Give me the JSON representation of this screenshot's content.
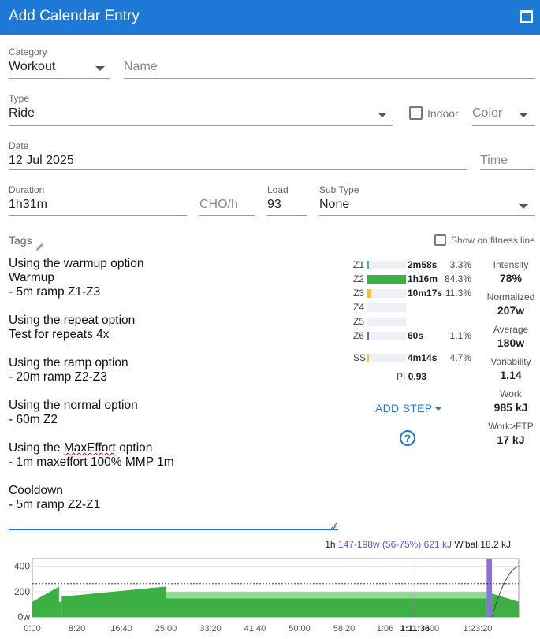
{
  "window": {
    "title": "Add Calendar Entry"
  },
  "form": {
    "category": {
      "label": "Category",
      "value": "Workout"
    },
    "name": {
      "placeholder": "Name"
    },
    "type": {
      "label": "Type",
      "value": "Ride"
    },
    "indoor": {
      "label": "Indoor",
      "checked": false
    },
    "color": {
      "placeholder": "Color"
    },
    "date": {
      "label": "Date",
      "value": "12 Jul 2025"
    },
    "time": {
      "placeholder": "Time"
    },
    "duration": {
      "label": "Duration",
      "value": "1h31m"
    },
    "cho": {
      "placeholder": "CHO/h"
    },
    "load": {
      "label": "Load",
      "value": "93"
    },
    "subtype": {
      "label": "Sub Type",
      "value": "None"
    },
    "tags": {
      "label": "Tags"
    },
    "fitness_line": {
      "label": "Show on fitness line",
      "checked": false
    }
  },
  "description": {
    "lines": [
      "Using the warmup option",
      "Warmup",
      "- 5m ramp Z1-Z3",
      "",
      "Using the repeat option",
      "Test for repeats 4x",
      "",
      "Using the ramp option",
      "- 20m ramp Z2-Z3",
      "",
      "Using the normal option",
      "- 60m Z2",
      "",
      "Using the ",
      "- 1m maxeffort 100% MMP 1m",
      "",
      "Cooldown",
      "- 5m ramp Z2-Z1"
    ],
    "maxeffort_word": "MaxEffort",
    "maxeffort_suffix": " option"
  },
  "zones": [
    {
      "name": "Z1",
      "time": "2m58s",
      "pct": "3.3%",
      "frac": 0.033,
      "color": "#3cbf8f"
    },
    {
      "name": "Z2",
      "time": "1h16m",
      "pct": "84.3%",
      "frac": 1.0,
      "color": "#3cb043"
    },
    {
      "name": "Z3",
      "time": "10m17s",
      "pct": "11.3%",
      "frac": 0.12,
      "color": "#f5c12e"
    },
    {
      "name": "Z4",
      "time": "",
      "pct": "",
      "frac": 0,
      "color": "#f08a24"
    },
    {
      "name": "Z5",
      "time": "",
      "pct": "",
      "frac": 0,
      "color": "#e5484d"
    },
    {
      "name": "Z6",
      "time": "60s",
      "pct": "1.1%",
      "frac": 0.02,
      "color": "#9b59b6"
    },
    {
      "name": "SS",
      "time": "4m14s",
      "pct": "4.7%",
      "frac": 0.06,
      "color": "#f5c12e"
    }
  ],
  "pi": {
    "label": "PI",
    "value": "0.93"
  },
  "actions": {
    "add_step": "ADD STEP",
    "help": "?"
  },
  "metrics": [
    {
      "label": "Intensity",
      "value": "78%"
    },
    {
      "label": "Normalized",
      "value": "207w"
    },
    {
      "label": "Average",
      "value": "180w"
    },
    {
      "label": "Variability",
      "value": "1.14"
    },
    {
      "label": "Work",
      "value": "985 kJ"
    },
    {
      "label": "Work>FTP",
      "value": "17 kJ"
    }
  ],
  "chart_info": {
    "time": "1h",
    "range": "147-198w (56-75%)",
    "work": "621 kJ",
    "wbal": "W'bal 18.2 kJ"
  },
  "chart_data": {
    "type": "area",
    "y_ticks": [
      "400",
      "200",
      "0w"
    ],
    "ylim": [
      0,
      460
    ],
    "x_ticks": [
      "0:00",
      "8:20",
      "16:40",
      "25:00",
      "33:20",
      "41:40",
      "50:00",
      "58:20",
      "1:06",
      "1:11:36",
      ":00",
      "1:23:20"
    ],
    "x_tick_seconds": [
      0,
      500,
      1000,
      1500,
      2000,
      2500,
      3000,
      3500,
      3960,
      4296,
      4500,
      5000
    ],
    "xlim_seconds": [
      0,
      5460
    ],
    "ftp_line_watts": 263,
    "cursor_seconds": 4296,
    "steps": [
      {
        "from_s": 0,
        "to_s": 300,
        "w_start": 120,
        "w_end": 240
      },
      {
        "from_s": 300,
        "to_s": 330,
        "w_start": 120,
        "w_end": 120
      },
      {
        "from_s": 330,
        "to_s": 1500,
        "w_start": 160,
        "w_end": 240
      },
      {
        "from_s": 1500,
        "to_s": 5100,
        "w_start": 198,
        "w_end": 198,
        "band_low": 147
      },
      {
        "from_s": 5100,
        "to_s": 5160,
        "w_start": 460,
        "w_end": 460,
        "color": "#8e6ee0"
      },
      {
        "from_s": 5160,
        "to_s": 5460,
        "w_start": 185,
        "w_end": 120
      }
    ]
  }
}
